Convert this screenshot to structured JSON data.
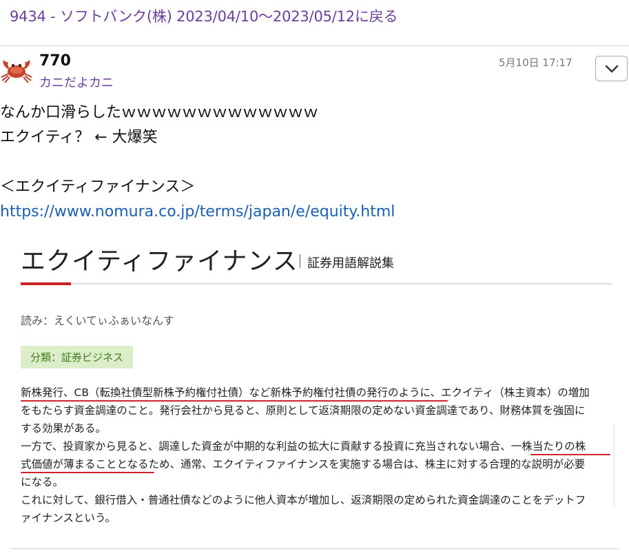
{
  "header": {
    "back_link": "9434 - ソフトバンク(株) 2023/04/10〜2023/05/12に戻る"
  },
  "post": {
    "number": "770",
    "poster": "カニだよカニ",
    "time": "5月10日 17:17",
    "menu_icon": "chevron-down-icon",
    "avatar_icon": "crab-icon",
    "lines": [
      "なんか口滑らしたｗｗｗｗｗｗｗｗｗｗｗｗｗ",
      "エクイティ？ ← 大爆笑",
      "",
      "＜エクイティファイナンス＞"
    ],
    "link": "https://www.nomura.co.jp/terms/japan/e/equity.html"
  },
  "embed": {
    "title": "エクイティファイナンス",
    "subtitle": "証券用語解説集",
    "reading": "読み：えくいてぃふぁいなんす",
    "category": "分類：証券ビジネス",
    "text_lines": [
      "新株発行、CB（転換社債型新株予約権付社債）など新株予約権付社債の発行のように、エクイティ（株主資本）の増加",
      "をもたらす資金調達のこと。発行会社から見ると、原則として返済期限の定めない資金調達であり、財務体質を強固に",
      "する効果がある。",
      "一方で、投資家から見ると、調達した資金が中期的な利益の拡大に貢献する投資に充当されない場合、一株当たりの株",
      "式価値が薄まることとなるため、通常、エクイティファイナンスを実施する場合は、株主に対する合理的な説明が必要",
      "になる。",
      "これに対して、銀行借入・普通社債などのように他人資本が増加し、返済期限の定められた資金調達のことをデットフ",
      "ァイナンスという。"
    ],
    "accent_color": "#cc1f1f",
    "underline_color": "#d2232a"
  },
  "colors": {
    "link_purple": "#6a3f9b",
    "link_blue": "#1a5fb4"
  }
}
